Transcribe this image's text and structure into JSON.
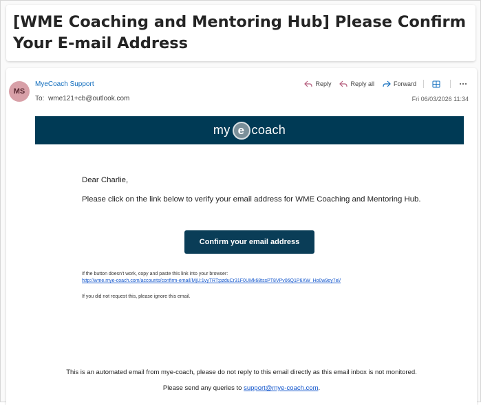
{
  "email": {
    "subject": "[WME Coaching and Mentoring Hub] Please Confirm Your E-mail Address",
    "sender": "MyeCoach Support",
    "avatar_initials": "MS",
    "to_label": "To:",
    "to": "wme121+cb@outlook.com",
    "date": "Fri 06/03/2026 11:34"
  },
  "actions": {
    "reply": "Reply",
    "reply_all": "Reply all",
    "forward": "Forward"
  },
  "banner": {
    "logo_left": "my",
    "logo_e": "e",
    "logo_right": "coach"
  },
  "body": {
    "greeting": "Dear Charlie,",
    "paragraph": "Please click on the link below to verify your email address for WME Coaching and Mentoring Hub.",
    "button_label": "Confirm your email address",
    "fallback_text": "If the button doesn't work, copy and paste this link into your browser:",
    "link": "http://wme.mye-coach.com/accounts/confirm-email/MjU:1vyTRT:pzduCr31F0UMk68tssPT8VPv06Q1P6XW_Ho0w9oy7el/",
    "ignore_text": "If you did not request this, please ignore this email."
  },
  "footer": {
    "line1": "This is an automated email from mye-coach, please do not reply to this email directly as this email inbox is not monitored.",
    "line2_prefix": "Please send any queries to ",
    "support_email": "support@mye-coach.com",
    "line2_suffix": "."
  },
  "colors": {
    "banner": "#003a55",
    "button": "#0a3d57",
    "link": "#1155cc",
    "sender": "#0f6cbd",
    "avatar": "#d8a0a8"
  }
}
